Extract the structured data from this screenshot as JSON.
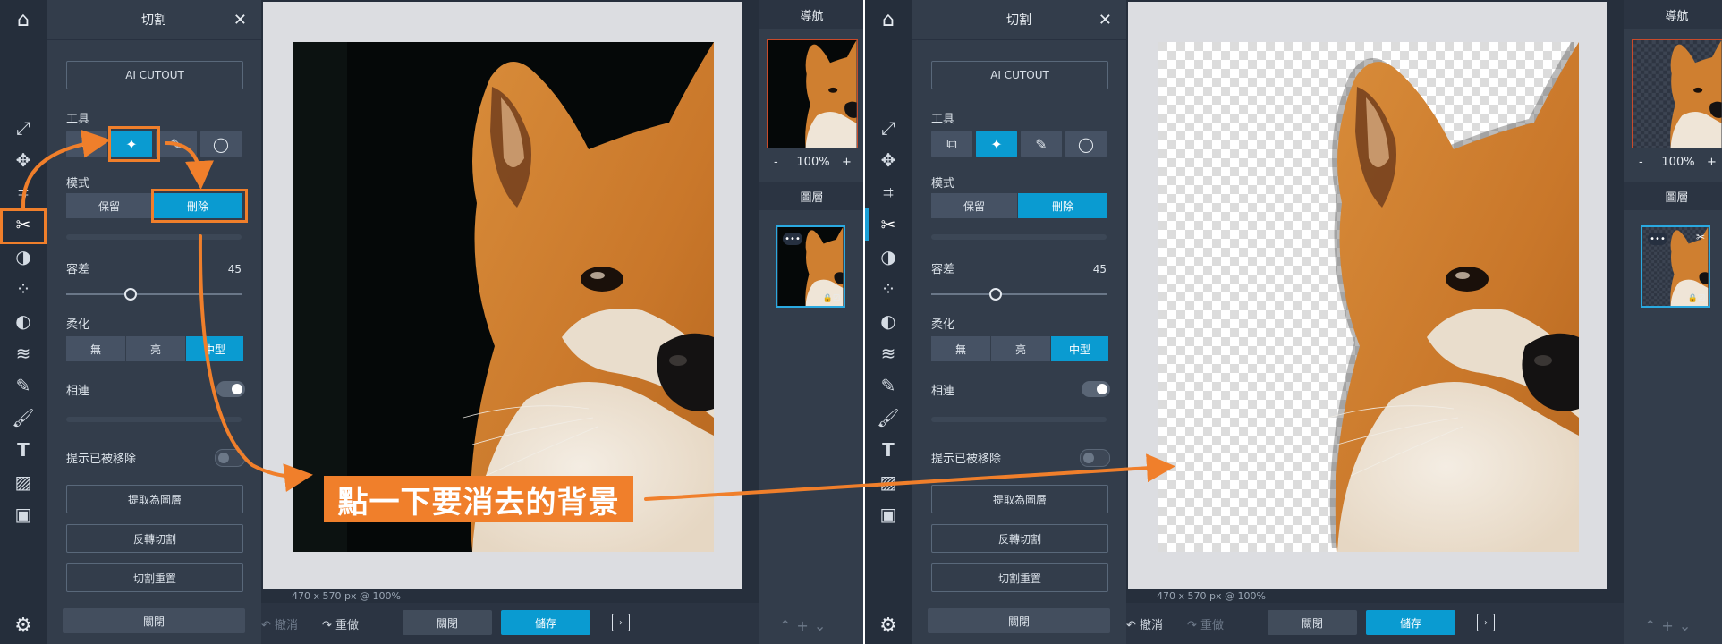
{
  "panel": {
    "title": "切割",
    "close_icon": "✕",
    "ai_cutout_label": "AI CUTOUT",
    "tools_label": "工具",
    "mode_label": "模式",
    "mode_keep": "保留",
    "mode_delete": "刪除",
    "tolerance_label": "容差",
    "tolerance_value": "45",
    "tolerance_level": 0.33,
    "feather_label": "柔化",
    "feather_none": "無",
    "feather_light": "亮",
    "feather_medium": "中型",
    "contiguous_label": "相連",
    "show_removed_label": "提示已被移除",
    "extract_layer_label": "提取為圖層",
    "invert_label": "反轉切割",
    "reset_label": "切割重置",
    "close_label": "關閉"
  },
  "canvas": {
    "size_info": "470 x 570 px @ 100%"
  },
  "bottombar": {
    "undo_label": "撤消",
    "redo_label": "重做",
    "close_label": "關閉",
    "save_label": "儲存"
  },
  "navigator": {
    "title": "導航",
    "zoom_minus": "-",
    "zoom_value": "100%",
    "zoom_plus": "+"
  },
  "layers": {
    "title": "圖層",
    "dots": "•••"
  },
  "annotation": {
    "callout_text": "點一下要消去的背景"
  },
  "colors": {
    "accent": "#0a9bd1",
    "annotation": "#f07f2b",
    "panel_bg": "#333d4b"
  },
  "icons": [
    "home-icon",
    "transform-icon",
    "move-icon",
    "crop-icon",
    "scissors-icon",
    "adjust-icon",
    "filter-icon",
    "vignette-icon",
    "wave-icon",
    "dropper-icon",
    "brush-icon",
    "text-icon",
    "texture-icon",
    "image-icon",
    "gear-icon"
  ]
}
